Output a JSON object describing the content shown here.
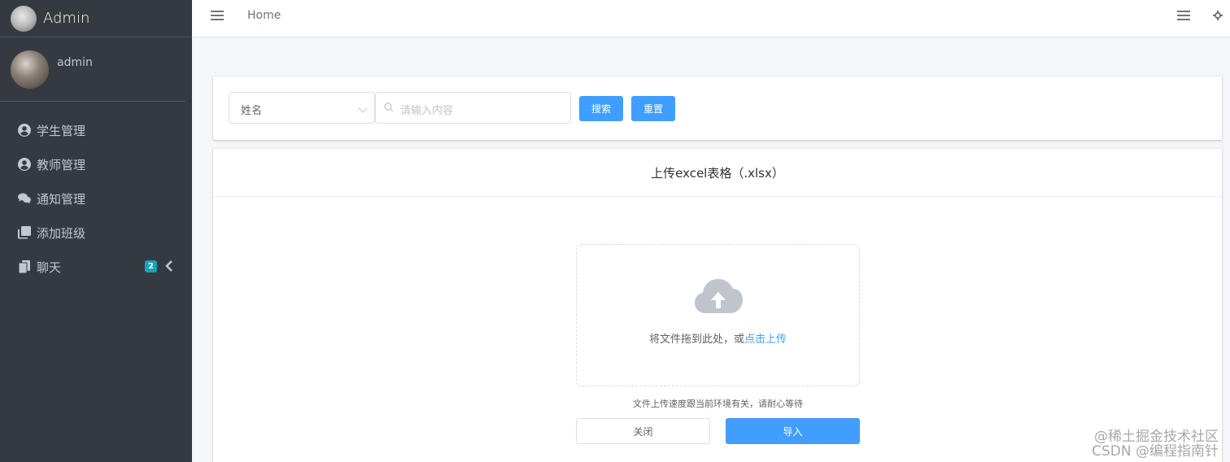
{
  "brand": {
    "title": "Admin"
  },
  "user": {
    "name": "admin"
  },
  "sidebar": {
    "items": [
      {
        "label": "学生管理",
        "icon": "user-circle-icon"
      },
      {
        "label": "教师管理",
        "icon": "user-circle-icon"
      },
      {
        "label": "通知管理",
        "icon": "comments-icon"
      },
      {
        "label": "添加班级",
        "icon": "clone-icon"
      },
      {
        "label": "聊天",
        "icon": "copy-icon",
        "badge": "2"
      }
    ]
  },
  "navbar": {
    "home": "Home"
  },
  "search": {
    "select_value": "姓名",
    "placeholder": "请输入内容",
    "search_label": "搜索",
    "reset_label": "重置"
  },
  "upload": {
    "title": "上传excel表格（.xlsx）",
    "drop_text": "将文件拖到此处，或",
    "drop_link": "点击上传",
    "tip": "文件上传速度跟当前环境有关，请耐心等待",
    "close_label": "关闭",
    "import_label": "导入"
  },
  "watermark": {
    "line1": "@稀土掘金技术社区",
    "line2": "CSDN @编程指南针"
  },
  "colors": {
    "sidebar_bg": "#343a40",
    "primary": "#409eff",
    "badge": "#17a2b8"
  }
}
